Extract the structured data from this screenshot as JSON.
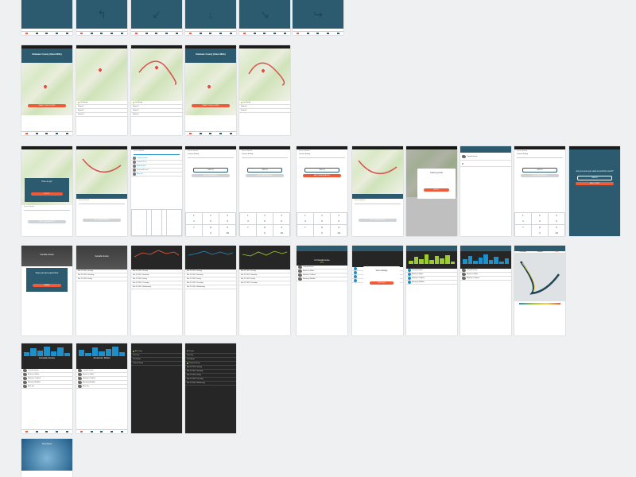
{
  "colors": {
    "teal": "#2c5a6e",
    "accent": "#ef5a38",
    "blue": "#1e8fc9",
    "green": "#9ccb2e",
    "dark": "#262626"
  },
  "map_screen": {
    "title": "Delaware County (Glenn Mills)",
    "button": "START YOUR COUNT"
  },
  "route_list": {
    "items": [
      "1st Round",
      "Round 1",
      "Round 2",
      "Round 3",
      "Round 4"
    ]
  },
  "popup_go": {
    "title": "Here we go!",
    "button": "GOT IT"
  },
  "popup_care": {
    "title": "Check your list",
    "button": "GOT IT"
  },
  "popup_end": {
    "title": "Are you sure you want to end this count?",
    "cancel": "CANCEL",
    "confirm": "END COUNT"
  },
  "species": {
    "label": "Species Spotted",
    "count_label": "Quantity",
    "placeholder": "Common Starling",
    "add": "ADD OBSERVATION",
    "cancel": "CANCEL"
  },
  "search_list": {
    "items": [
      "Canada Goose",
      "Gadwall Duck",
      "Mallard Duck",
      "Red-tailed Hawk",
      "Blue Jay"
    ]
  },
  "location_title": "Canada Goose",
  "popup_hope": {
    "title": "Hope you had a good time!",
    "button": "SHARE"
  },
  "dates": [
    "Mar 24 2015, Sunday",
    "Mar 23 2015, Saturday",
    "Mar 22 2015, Friday",
    "Mar 21 2015, Thursday",
    "Mar 20 2015, Wednesday"
  ],
  "totals": {
    "species": "14 Species",
    "birds": "14 Canada Goose",
    "pct": "23%"
  },
  "birds": [
    "Canada Goose",
    "American Robin",
    "Northern Cardinal",
    "Mourning Warbler",
    "Blue Jay"
  ],
  "popup_range": {
    "title": "View a Range",
    "button": "LET'S GO"
  },
  "totals_label": "All Time",
  "goose_title": "Canada Goose",
  "robin_title": "American Robin",
  "menu": {
    "items": [
      "All Counts",
      "This Year",
      "This Month",
      "Custom Group"
    ]
  },
  "menu_dark": {
    "items": [
      "All Counts",
      "This Year",
      "This Month",
      "Custom Group"
    ]
  },
  "splash": {
    "title": "Get there"
  },
  "tabs": [
    "Overview",
    "Timeline",
    "Map"
  ],
  "stats": [
    "24",
    "101",
    "31",
    "48"
  ]
}
